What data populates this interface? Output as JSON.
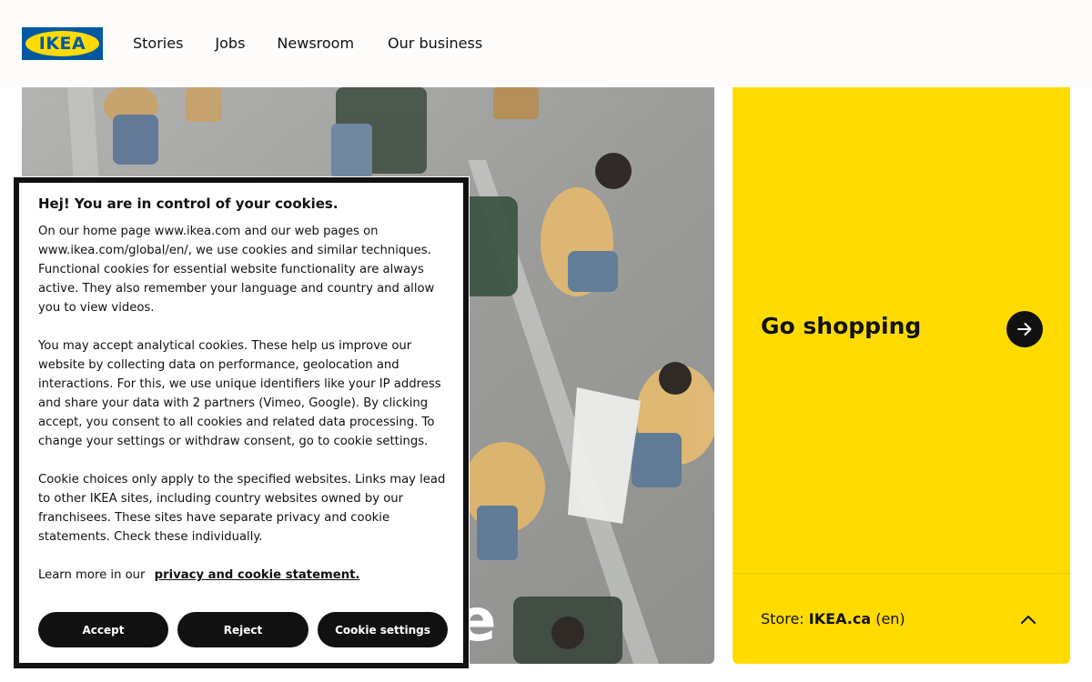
{
  "header": {
    "logo_text": "IKEA",
    "nav": [
      {
        "label": "Stories"
      },
      {
        "label": "Jobs"
      },
      {
        "label": "Newsroom"
      },
      {
        "label": "Our business"
      }
    ]
  },
  "hero": {
    "visible_letter": "e"
  },
  "shop_card": {
    "title": "Go shopping",
    "store_label": "Store:",
    "store_name": "IKEA.ca",
    "store_lang": "(en)"
  },
  "cookie_dialog": {
    "title": "Hej! You are in control of your cookies.",
    "paragraph1": "On our home page www.ikea.com and our web pages on www.ikea.com/global/en/, we use cookies and similar techniques. Functional cookies for essential website functionality are always active. They also remember your language and country and allow you to view videos.",
    "paragraph2": "You may accept analytical cookies. These help us improve our website by collecting data on performance, geolocation and interactions. For this, we use unique identifiers like your IP address and share your data with 2 partners (Vimeo, Google). By clicking accept, you consent to all cookies and related data processing. To change your settings or withdraw consent, go to cookie settings.",
    "paragraph3": "Cookie choices only apply to the specified websites. Links may lead to other IKEA sites, including country websites owned by our franchisees. These sites have separate privacy and cookie statements. Check these individually.",
    "learn_more_text": "Learn more in our",
    "learn_more_link": "privacy and cookie statement.",
    "buttons": {
      "accept": "Accept",
      "reject": "Reject",
      "settings": "Cookie settings"
    }
  },
  "colors": {
    "ikea_blue": "#0058a3",
    "ikea_yellow": "#ffdb00",
    "text": "#111111"
  },
  "icons": {
    "shop_arrow": "arrow-right-icon",
    "store_toggle": "chevron-up-icon"
  }
}
